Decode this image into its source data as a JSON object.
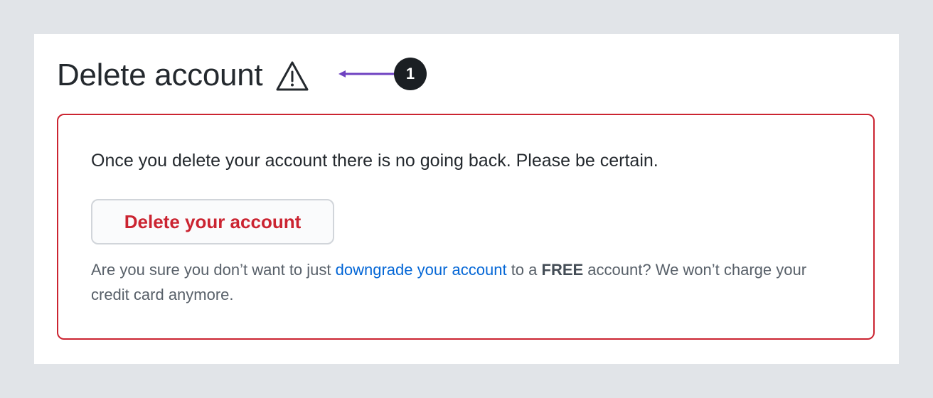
{
  "header": {
    "title": "Delete account",
    "icon": "warning-icon"
  },
  "callout": {
    "number": "1",
    "arrow_color": "#6f42c1"
  },
  "danger_zone": {
    "warning_text": "Once you delete your account there is no going back. Please be certain.",
    "delete_button_label": "Delete your account",
    "hint_prefix": "Are you sure you don’t want to just ",
    "hint_link": "downgrade your account",
    "hint_middle": " to a ",
    "hint_bold": "FREE",
    "hint_suffix": " account? We won’t charge your credit card anymore."
  },
  "colors": {
    "background": "#e1e4e8",
    "panel": "#ffffff",
    "danger": "#cb2431",
    "link": "#0366d6",
    "text": "#24292e",
    "muted": "#586069",
    "badge": "#1b1f23",
    "arrow": "#6f42c1"
  }
}
